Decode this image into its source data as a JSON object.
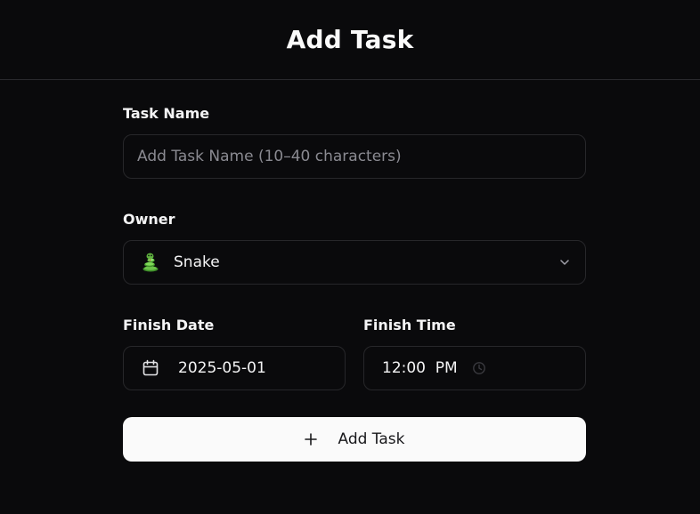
{
  "header": {
    "title": "Add Task"
  },
  "form": {
    "task_name": {
      "label": "Task Name",
      "placeholder": "Add Task Name (10–40 characters)",
      "value": ""
    },
    "owner": {
      "label": "Owner",
      "selected": "Snake",
      "icon": "snake-emoji-icon"
    },
    "finish_date": {
      "label": "Finish Date",
      "value": "2025-05-01",
      "icon": "calendar-icon"
    },
    "finish_time": {
      "label": "Finish Time",
      "value": "12:00  PM",
      "icon": "clock-icon"
    },
    "submit": {
      "label": "Add Task",
      "icon": "plus-icon"
    }
  },
  "colors": {
    "background": "#0a0a0c",
    "border": "#27272a",
    "button_bg": "#fafafa",
    "button_text": "#18181b",
    "placeholder": "#8a8a91"
  }
}
